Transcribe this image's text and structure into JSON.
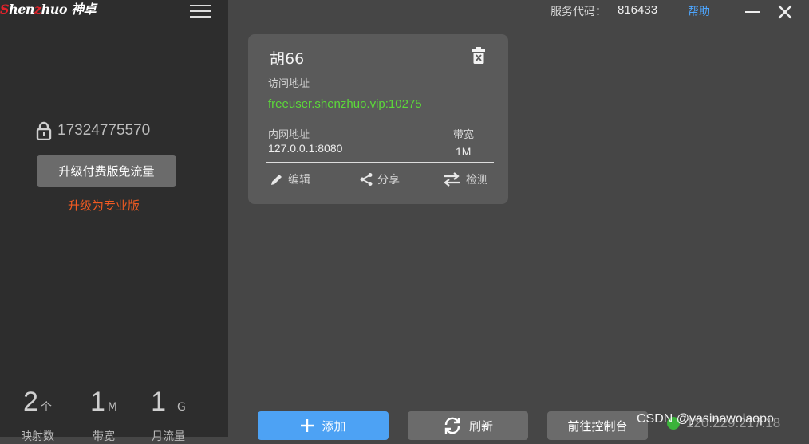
{
  "app": {
    "logo_prefix": "S",
    "logo_mid": "hen",
    "logo_z": "z",
    "logo_rest": "huo",
    "logo_cn": "神卓"
  },
  "sidebar": {
    "phone": "17324775570",
    "upgrade_button": "升级付费版免流量",
    "pro_link": "升级为专业版",
    "stats": [
      {
        "value": "2",
        "unit": "个",
        "label": "映射数"
      },
      {
        "value": "1",
        "unit": "M",
        "label": "带宽"
      },
      {
        "value": "1",
        "unit": "G",
        "label": "月流量"
      }
    ]
  },
  "header": {
    "service_label": "服务代码：",
    "service_code": "816433",
    "help": "帮助"
  },
  "card": {
    "name": "胡66",
    "addr_label": "访问地址",
    "addr": "freeuser.shenzhuo.vip:10275",
    "lan_label": "内网地址",
    "lan": "127.0.0.1:8080",
    "bw_label": "带宽",
    "bw": "1M",
    "actions": {
      "edit": "编辑",
      "share": "分享",
      "check": "检测"
    }
  },
  "bottom": {
    "add": "添加",
    "refresh": "刷新",
    "console": "前往控制台",
    "ip": "120.229.217.18",
    "watermark": "CSDN @yasinawolaopo"
  },
  "colors": {
    "accent_blue": "#4da2f4",
    "address_green": "#5cd83a",
    "pro_orange": "#f05a22",
    "online_green": "#3bb33b"
  }
}
